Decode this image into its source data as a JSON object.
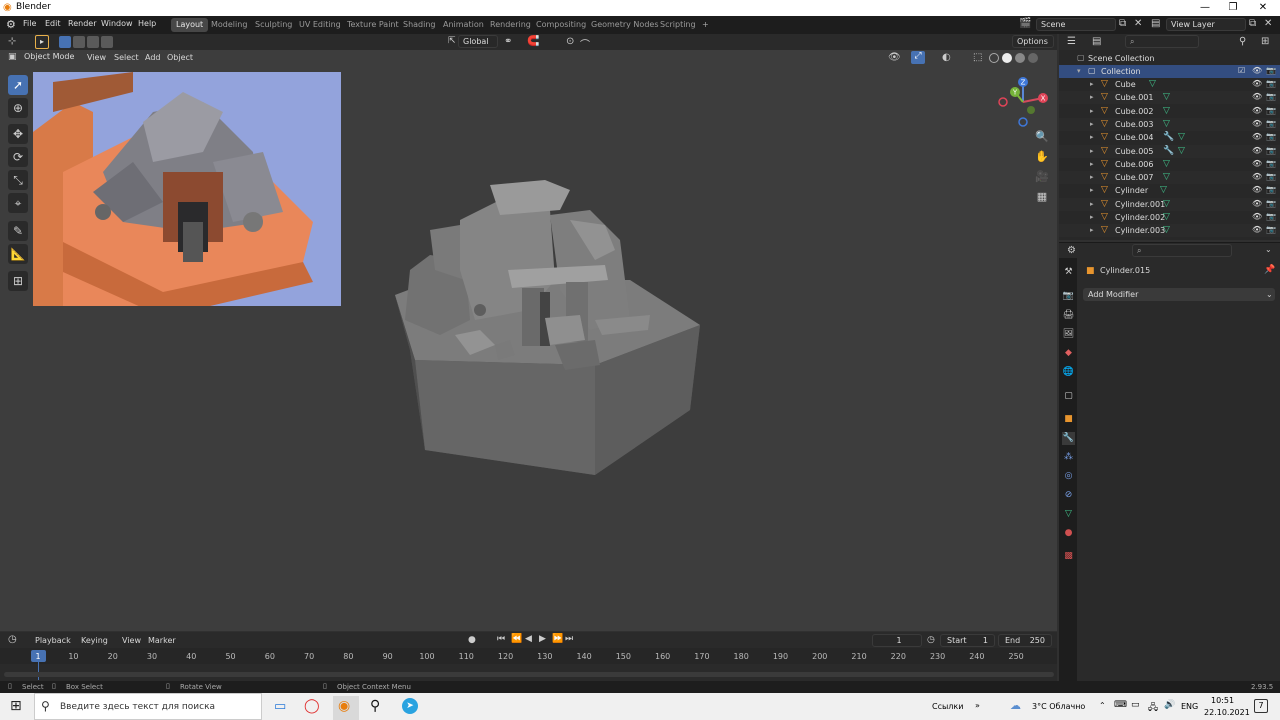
{
  "window": {
    "title": "Blender"
  },
  "menu": [
    "File",
    "Edit",
    "Render",
    "Window",
    "Help"
  ],
  "workspaces": [
    "Layout",
    "Modeling",
    "Sculpting",
    "UV Editing",
    "Texture Paint",
    "Shading",
    "Animation",
    "Rendering",
    "Compositing",
    "Geometry Nodes",
    "Scripting"
  ],
  "scene": {
    "name": "Scene",
    "view_layer": "View Layer"
  },
  "viewport": {
    "transform_orientation": "Global",
    "options_label": "Options",
    "mode": "Object Mode",
    "header_menu": [
      "View",
      "Select",
      "Add",
      "Object"
    ]
  },
  "gizmo": {
    "z": "Z",
    "y": "Y",
    "x": "X"
  },
  "outliner": {
    "root": "Scene Collection",
    "collection": "Collection",
    "items": [
      "Cube",
      "Cube.001",
      "Cube.002",
      "Cube.003",
      "Cube.004",
      "Cube.005",
      "Cube.006",
      "Cube.007",
      "Cylinder",
      "Cylinder.001",
      "Cylinder.002",
      "Cylinder.003"
    ]
  },
  "properties": {
    "object_name": "Cylinder.015",
    "add_modifier": "Add Modifier"
  },
  "timeline": {
    "menu": [
      "Playback",
      "Keying",
      "View",
      "Marker"
    ],
    "current_frame": "1",
    "start_label": "Start",
    "start": "1",
    "end_label": "End",
    "end": "250",
    "ticks": [
      "1",
      "10",
      "20",
      "30",
      "40",
      "50",
      "60",
      "70",
      "80",
      "90",
      "100",
      "110",
      "120",
      "130",
      "140",
      "150",
      "160",
      "170",
      "180",
      "190",
      "200",
      "210",
      "220",
      "230",
      "240",
      "250"
    ]
  },
  "statusbar": {
    "select": "Select",
    "box_select": "Box Select",
    "rotate_view": "Rotate View",
    "context_menu": "Object Context Menu",
    "version": "2.93.5"
  },
  "taskbar": {
    "search_placeholder": "Введите здесь текст для поиска",
    "links": "Ссылки",
    "weather": "3°C  Облачно",
    "lang": "ENG",
    "time": "10:51",
    "date": "22.10.2021",
    "notifications": "7"
  },
  "colors": {
    "accent": "#4772b3",
    "object": "#e8952e",
    "mesh": "#41c48c",
    "active_tab": "#474747"
  }
}
